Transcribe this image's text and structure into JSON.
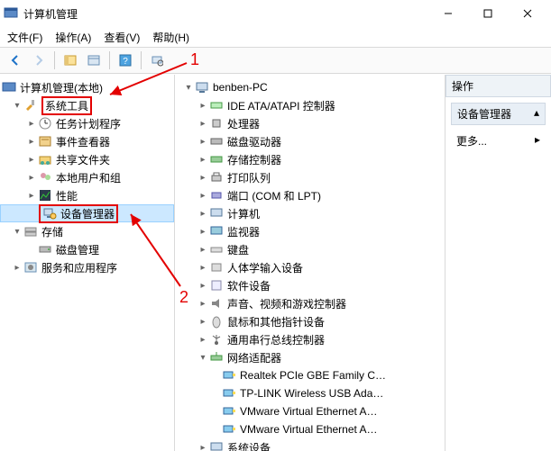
{
  "window": {
    "title": "计算机管理",
    "min": "–",
    "max": "☐",
    "close": "✕"
  },
  "menu": {
    "file": "文件(F)",
    "action": "操作(A)",
    "view": "查看(V)",
    "help": "帮助(H)"
  },
  "annotations": {
    "n1": "1",
    "n2": "2"
  },
  "left_tree": {
    "root": "计算机管理(本地)",
    "systools": "系统工具",
    "task_scheduler": "任务计划程序",
    "event_viewer": "事件查看器",
    "shared_folders": "共享文件夹",
    "local_users": "本地用户和组",
    "performance": "性能",
    "device_manager": "设备管理器",
    "storage": "存储",
    "disk_mgmt": "磁盘管理",
    "services_apps": "服务和应用程序"
  },
  "mid_tree": {
    "root": "benben-PC",
    "ide": "IDE ATA/ATAPI 控制器",
    "cpu": "处理器",
    "disk_drive": "磁盘驱动器",
    "storage_ctrl": "存储控制器",
    "print_queue": "打印队列",
    "ports": "端口 (COM 和 LPT)",
    "computer": "计算机",
    "monitors": "监视器",
    "keyboards": "键盘",
    "hid": "人体学输入设备",
    "software_dev": "软件设备",
    "sound": "声音、视频和游戏控制器",
    "mice": "鼠标和其他指针设备",
    "usb": "通用串行总线控制器",
    "net_adapters": "网络适配器",
    "nic1": "Realtek PCIe GBE Family C…",
    "nic2": "TP-LINK Wireless USB Ada…",
    "nic3": "VMware Virtual Ethernet A…",
    "nic4": "VMware Virtual Ethernet A…",
    "system_dev": "系统设备"
  },
  "actions": {
    "header": "操作",
    "dev_mgr": "设备管理器",
    "more": "更多..."
  }
}
